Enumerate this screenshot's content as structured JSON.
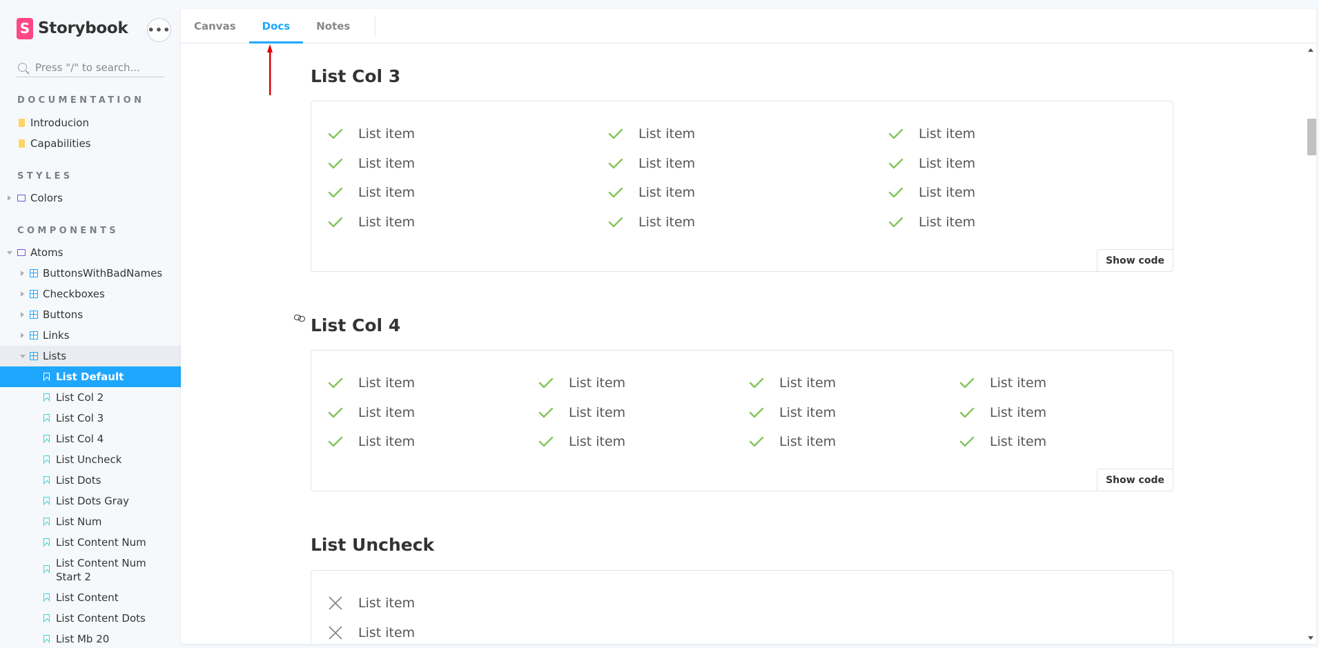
{
  "brand": {
    "name": "Storybook",
    "logo_letter": "S",
    "logo_color": "#ff4785"
  },
  "menu_button": {
    "label": "•••"
  },
  "search": {
    "placeholder": "Press \"/\" to search..."
  },
  "sidebar": {
    "sections": [
      {
        "title": "DOCUMENTATION"
      },
      {
        "title": "STYLES"
      },
      {
        "title": "COMPONENTS"
      }
    ],
    "items": [
      {
        "label": "Introducion",
        "icon": "document-icon"
      },
      {
        "label": "Capabilities",
        "icon": "document-icon"
      },
      {
        "label": "Colors",
        "icon": "folder-icon"
      },
      {
        "label": "Atoms",
        "icon": "folder-icon"
      },
      {
        "label": "ButtonsWithBadNames",
        "icon": "component-icon"
      },
      {
        "label": "Checkboxes",
        "icon": "component-icon"
      },
      {
        "label": "Buttons",
        "icon": "component-icon"
      },
      {
        "label": "Links",
        "icon": "component-icon"
      },
      {
        "label": "Lists",
        "icon": "component-icon"
      },
      {
        "label": "List Default",
        "icon": "bookmark-icon"
      },
      {
        "label": "List Col 2",
        "icon": "bookmark-icon"
      },
      {
        "label": "List Col 3",
        "icon": "bookmark-icon"
      },
      {
        "label": "List Col 4",
        "icon": "bookmark-icon"
      },
      {
        "label": "List Uncheck",
        "icon": "bookmark-icon"
      },
      {
        "label": "List Dots",
        "icon": "bookmark-icon"
      },
      {
        "label": "List Dots Gray",
        "icon": "bookmark-icon"
      },
      {
        "label": "List Num",
        "icon": "bookmark-icon"
      },
      {
        "label": "List Content Num",
        "icon": "bookmark-icon"
      },
      {
        "label": "List Content Num Start 2",
        "icon": "bookmark-icon"
      },
      {
        "label": "List Content",
        "icon": "bookmark-icon"
      },
      {
        "label": "List Content Dots",
        "icon": "bookmark-icon"
      },
      {
        "label": "List Mb 20",
        "icon": "bookmark-icon"
      }
    ],
    "selected": "List Default"
  },
  "tabs": [
    {
      "label": "Canvas"
    },
    {
      "label": "Docs"
    },
    {
      "label": "Notes"
    }
  ],
  "active_tab": "Docs",
  "docs": {
    "sections": [
      {
        "heading": "List Col 3",
        "item_label": "List item",
        "columns": 3,
        "rows": 4,
        "marker": "check-icon",
        "show_code": "Show code"
      },
      {
        "heading": "List Col 4",
        "item_label": "List item",
        "columns": 4,
        "rows": 3,
        "marker": "check-icon",
        "show_code": "Show code"
      },
      {
        "heading": "List Uncheck",
        "item_label": "List item",
        "columns": 1,
        "rows": 2,
        "marker": "cross-icon"
      }
    ]
  },
  "colors": {
    "accent": "#1ea7fd",
    "check": "#81c457",
    "annotation_arrow": "#e00000"
  }
}
